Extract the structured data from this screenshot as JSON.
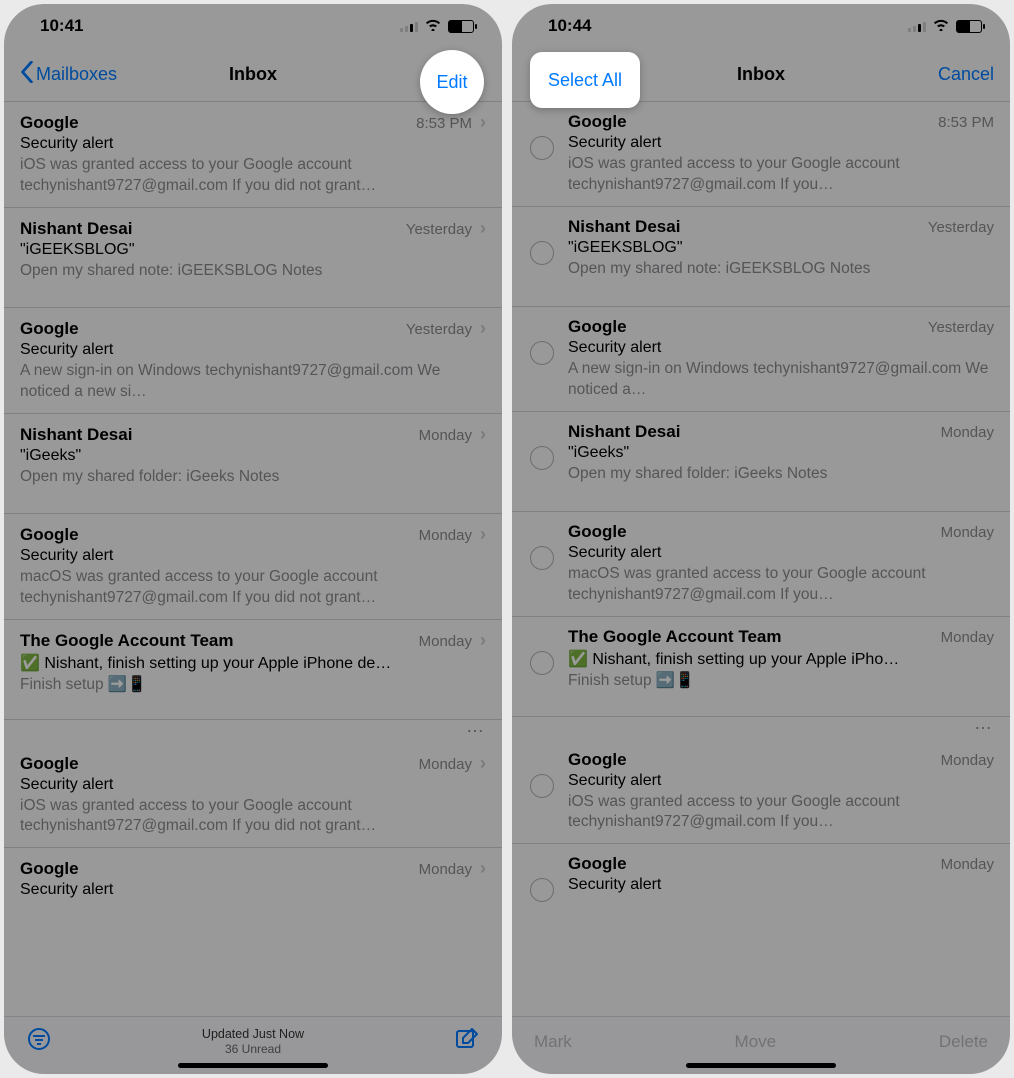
{
  "left": {
    "time": "10:41",
    "nav": {
      "back": "Mailboxes",
      "title": "Inbox",
      "edit": "Edit"
    },
    "emails": [
      {
        "sender": "Google",
        "time": "8:53 PM",
        "subject": "Security alert",
        "preview": "iOS was granted access to your Google account techynishant9727@gmail.com If you did not grant…"
      },
      {
        "sender": "Nishant Desai",
        "time": "Yesterday",
        "subject": "\"iGEEKSBLOG\"",
        "preview": "Open my shared note: iGEEKSBLOG Notes"
      },
      {
        "sender": "Google",
        "time": "Yesterday",
        "subject": "Security alert",
        "preview": "A new sign-in on Windows techynishant9727@gmail.com We noticed a new si…"
      },
      {
        "sender": "Nishant Desai",
        "time": "Monday",
        "subject": "\"iGeeks\"",
        "preview": "Open my shared folder: iGeeks Notes"
      },
      {
        "sender": "Google",
        "time": "Monday",
        "subject": "Security alert",
        "preview": "macOS was granted access to your Google account techynishant9727@gmail.com If you did not grant…"
      },
      {
        "sender": "The Google Account Team",
        "time": "Monday",
        "subject": "✅ Nishant, finish setting up your Apple iPhone de…",
        "preview": "Finish setup ➡️📱"
      },
      {
        "sender": "Google",
        "time": "Monday",
        "subject": "Security alert",
        "preview": "iOS was granted access to your Google account techynishant9727@gmail.com If you did not grant…"
      },
      {
        "sender": "Google",
        "time": "Monday",
        "subject": "Security alert",
        "preview": ""
      }
    ],
    "toolbar": {
      "status": "Updated Just Now",
      "unread": "36 Unread"
    }
  },
  "right": {
    "time": "10:44",
    "nav": {
      "selectAll": "Select All",
      "title": "Inbox",
      "cancel": "Cancel"
    },
    "emails": [
      {
        "sender": "Google",
        "time": "8:53 PM",
        "subject": "Security alert",
        "preview": "iOS was granted access to your Google account techynishant9727@gmail.com If you…"
      },
      {
        "sender": "Nishant Desai",
        "time": "Yesterday",
        "subject": "\"iGEEKSBLOG\"",
        "preview": "Open my shared note: iGEEKSBLOG Notes"
      },
      {
        "sender": "Google",
        "time": "Yesterday",
        "subject": "Security alert",
        "preview": "A new sign-in on Windows techynishant9727@gmail.com We noticed a…"
      },
      {
        "sender": "Nishant Desai",
        "time": "Monday",
        "subject": "\"iGeeks\"",
        "preview": "Open my shared folder: iGeeks Notes"
      },
      {
        "sender": "Google",
        "time": "Monday",
        "subject": "Security alert",
        "preview": "macOS was granted access to your Google account techynishant9727@gmail.com If you…"
      },
      {
        "sender": "The Google Account Team",
        "time": "Monday",
        "subject": "✅ Nishant, finish setting up your Apple iPho…",
        "preview": "Finish setup ➡️📱"
      },
      {
        "sender": "Google",
        "time": "Monday",
        "subject": "Security alert",
        "preview": "iOS was granted access to your Google account techynishant9727@gmail.com If you…"
      },
      {
        "sender": "Google",
        "time": "Monday",
        "subject": "Security alert",
        "preview": ""
      }
    ],
    "toolbar": {
      "mark": "Mark",
      "move": "Move",
      "delete": "Delete"
    }
  }
}
